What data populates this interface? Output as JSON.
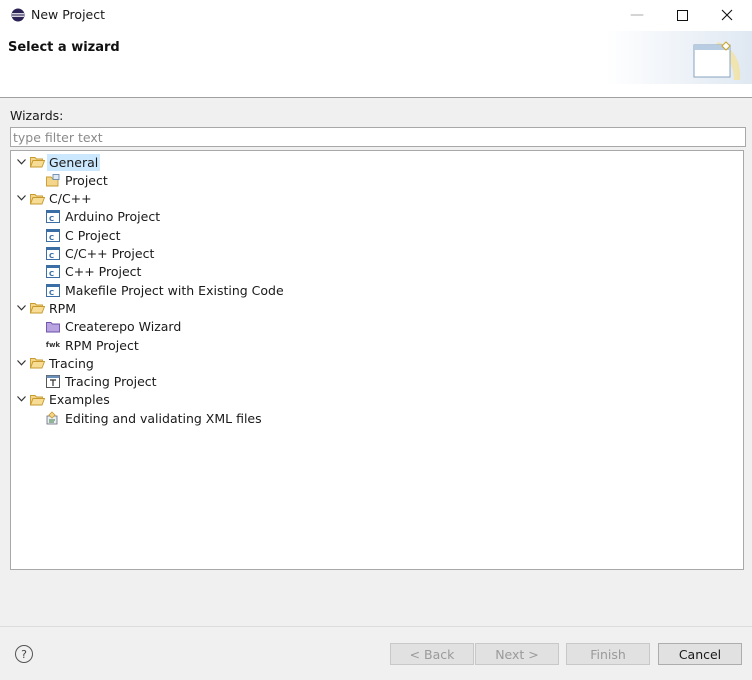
{
  "window": {
    "title": "New Project",
    "minimize_glyph": "—",
    "maximize_glyph": "☐",
    "close_glyph": "✕"
  },
  "header": {
    "title": "Select a wizard"
  },
  "filter": {
    "label": "Wizards:",
    "placeholder": "type filter text",
    "value": ""
  },
  "tree": [
    {
      "label": "General",
      "level": 0,
      "kind": "folder",
      "expanded": true,
      "selected": true
    },
    {
      "label": "Project",
      "level": 1,
      "kind": "project-icon"
    },
    {
      "label": "C/C++",
      "level": 0,
      "kind": "folder",
      "expanded": true
    },
    {
      "label": "Arduino Project",
      "level": 1,
      "kind": "c-project-icon"
    },
    {
      "label": "C Project",
      "level": 1,
      "kind": "c-project-icon"
    },
    {
      "label": "C/C++ Project",
      "level": 1,
      "kind": "c-project-icon"
    },
    {
      "label": "C++ Project",
      "level": 1,
      "kind": "c-project-icon"
    },
    {
      "label": "Makefile Project with Existing Code",
      "level": 1,
      "kind": "c-project-icon"
    },
    {
      "label": "RPM",
      "level": 0,
      "kind": "folder",
      "expanded": true
    },
    {
      "label": "Createrepo Wizard",
      "level": 1,
      "kind": "purple-folder-icon"
    },
    {
      "label": "RPM Project",
      "level": 1,
      "kind": "rpm-icon",
      "icon_text": "fwk"
    },
    {
      "label": "Tracing",
      "level": 0,
      "kind": "folder",
      "expanded": true
    },
    {
      "label": "Tracing Project",
      "level": 1,
      "kind": "tracing-project-icon"
    },
    {
      "label": "Examples",
      "level": 0,
      "kind": "folder",
      "expanded": true
    },
    {
      "label": "Editing and validating XML files",
      "level": 1,
      "kind": "xml-example-icon"
    }
  ],
  "buttons": {
    "help": "?",
    "back": "< Back",
    "next": "Next >",
    "finish": "Finish",
    "cancel": "Cancel"
  },
  "colors": {
    "selection": "#cce8ff",
    "folder": "#e8b850",
    "c_icon": "#3a6ea5"
  }
}
